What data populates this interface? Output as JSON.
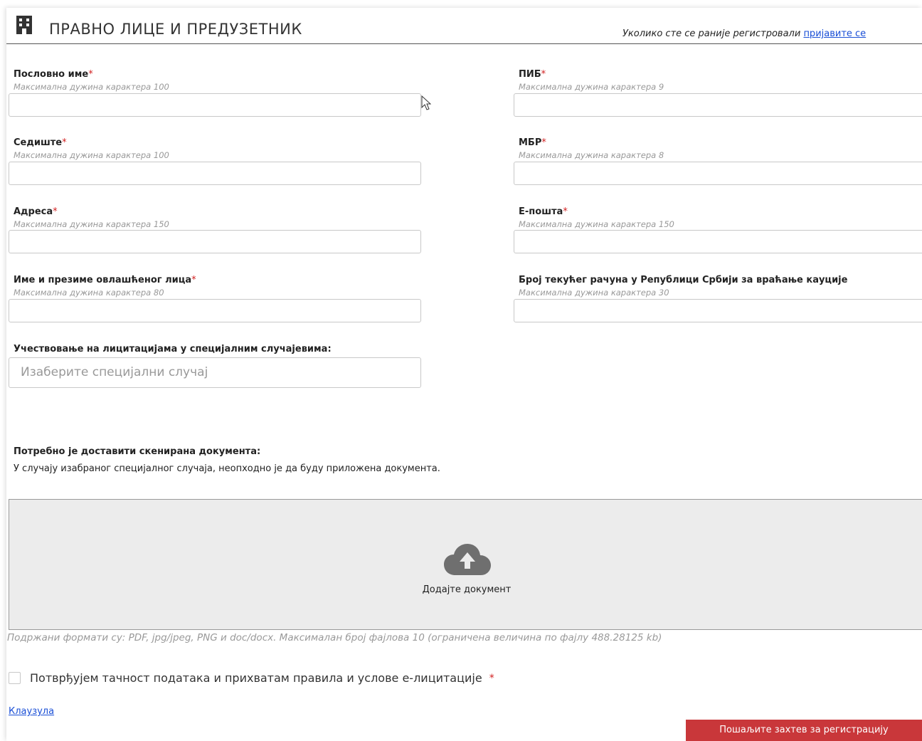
{
  "header": {
    "title": "ПРАВНО ЛИЦЕ И ПРЕДУЗЕТНИК",
    "login_prefix": "Уколико сте се раније регистровали ",
    "login_link": "пријавите се"
  },
  "fields": {
    "business_name": {
      "label": "Пословно име",
      "hint": "Максимална дужина карактера 100",
      "value": ""
    },
    "pib": {
      "label": "ПИБ",
      "hint": "Максимална дужина карактера 9",
      "value": ""
    },
    "seat": {
      "label": "Седиште",
      "hint": "Максимална дужина карактера 100",
      "value": ""
    },
    "mbr": {
      "label": "МБР",
      "hint": "Максимална дужина карактера 8",
      "value": ""
    },
    "address": {
      "label": "Адреса",
      "hint": "Максимална дужина карактера 150",
      "value": ""
    },
    "email": {
      "label": "Е-пошта",
      "hint": "Максимална дужина карактера 150",
      "value": ""
    },
    "authorized_person": {
      "label": "Име и презиме овлашћеног лица",
      "hint": "Максимална дужина карактера 80",
      "value": ""
    },
    "bank_account": {
      "label": "Број текућег рачуна у Републици Србији за враћање кауције",
      "hint": "Максимална дужина карактера 30",
      "value": ""
    }
  },
  "required_mark": "*",
  "special_cases": {
    "label": "Учествовање на лицитацијама у специјалним случајевима:",
    "placeholder": "Изаберите специјални случај"
  },
  "documents": {
    "title": "Потребно је доставити скенирана документа:",
    "note": "У случају изабраног специјалног случаја, неопходно је да буду приложена документа.",
    "dropzone_label": "Додајте документ",
    "formats": "Подржани формати су: PDF, jpg/jpeg, PNG и doc/docx. Максималан број фајлова 10 (ограничена величина по фајлу 488.28125 kb)"
  },
  "confirm": {
    "label": "Потврђујем тачност података и прихватам правила и услове е-лицитације",
    "checked": false
  },
  "clause_link": "Клаузула",
  "submit_label": "Пошаљите захтев за регистрацију",
  "colors": {
    "required": "#d12020",
    "link": "#1a4fd6",
    "submit_bg": "#c9373a",
    "dropzone_bg": "#ececec",
    "cloud_icon": "#6f6f6f"
  }
}
